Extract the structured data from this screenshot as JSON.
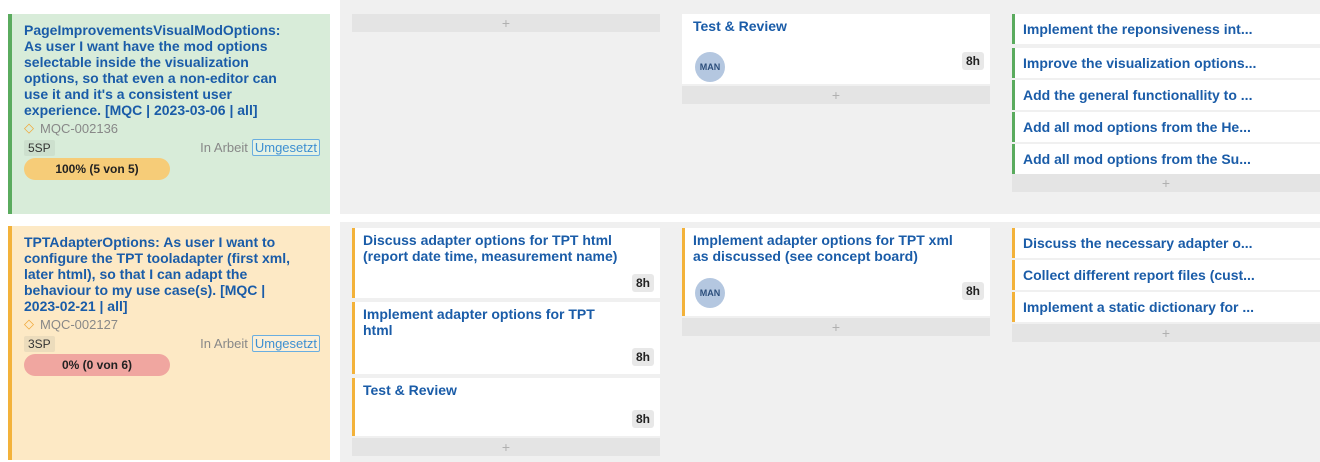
{
  "stories": [
    {
      "title": "PageImprovementsVisualModOptions: As user I want have the mod options selectable inside the visualization options, so that even a non-editor can use it and it's a consistent user experience. [MQC | 2023-03-06 | all]",
      "id": "MQC-002136",
      "sp": "5SP",
      "state": "In Arbeit",
      "badge": "Umgesetzt",
      "progress": "100% (5 von 5)",
      "progress_fraction": 1.0
    },
    {
      "title": "TPTAdapterOptions: As user I want to configure the TPT tooladapter (first xml, later html), so that I can adapt the behaviour to my use case(s). [MQC | 2023-02-21 | all]",
      "id": "MQC-002127",
      "sp": "3SP",
      "state": "In Arbeit",
      "badge": "Umgesetzt",
      "progress": "0% (0 von 6)",
      "progress_fraction": 0.0
    }
  ],
  "lane1": {
    "col3": {
      "title": "Test & Review",
      "avatar": "MAN",
      "hours": "8h"
    },
    "col4": [
      "Implement the reponsiveness int...",
      "Improve the visualization options...",
      "Add the general functionallity to ...",
      "Add all mod options from the He...",
      "Add all mod options from the Su..."
    ]
  },
  "lane2": {
    "col2": [
      {
        "title": "Discuss adapter options for TPT html (report date time, measurement name)",
        "hours": "8h"
      },
      {
        "title": "Implement adapter options for TPT html",
        "hours": "8h"
      },
      {
        "title": "Test & Review",
        "hours": "8h"
      }
    ],
    "col3": {
      "title": "Implement adapter options for TPT xml as discussed (see concept board)",
      "avatar": "MAN",
      "hours": "8h"
    },
    "col4": [
      "Discuss the necessary adapter o...",
      "Collect different report files (cust...",
      "Implement a static dictionary for ..."
    ]
  },
  "add_symbol": "+",
  "colors": {
    "green_story_bg": "#d8ecd9",
    "yellow_story_bg": "#fde9c5",
    "green_accent": "#5aab5e",
    "yellow_accent": "#f3b23a",
    "title_blue": "#1a5ca8"
  }
}
